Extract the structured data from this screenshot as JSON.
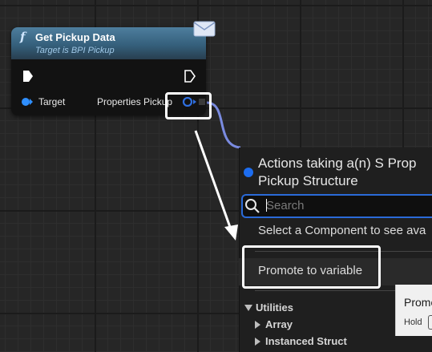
{
  "node": {
    "title": "Get Pickup Data",
    "subtitle": "Target is BPI Pickup",
    "fn_icon_glyph": "f",
    "target_label": "Target",
    "properties_label": "Properties Pickup",
    "header_color": "#35607c",
    "pin_color": "#2f8fff",
    "icons": [
      "function-icon",
      "message-envelope-icon",
      "exec-in-pin-icon",
      "exec-out-pin-icon",
      "object-pin-icon",
      "struct-pin-icon"
    ]
  },
  "menu": {
    "title_line1": "Actions taking a(n) S Prop",
    "title_line2": "Pickup Structure",
    "search_placeholder": "Search",
    "select_component_text": "Select a Component to see ava",
    "promote_label": "Promote to variable",
    "category": "Utilities",
    "tree_items": [
      "Array",
      "Instanced Struct"
    ]
  },
  "tooltip": {
    "title": "Promo",
    "hold_text": "Hold"
  },
  "colors": {
    "wire": "#7a8be0",
    "accent": "#1d6df0",
    "highlight": "#ffffff"
  }
}
